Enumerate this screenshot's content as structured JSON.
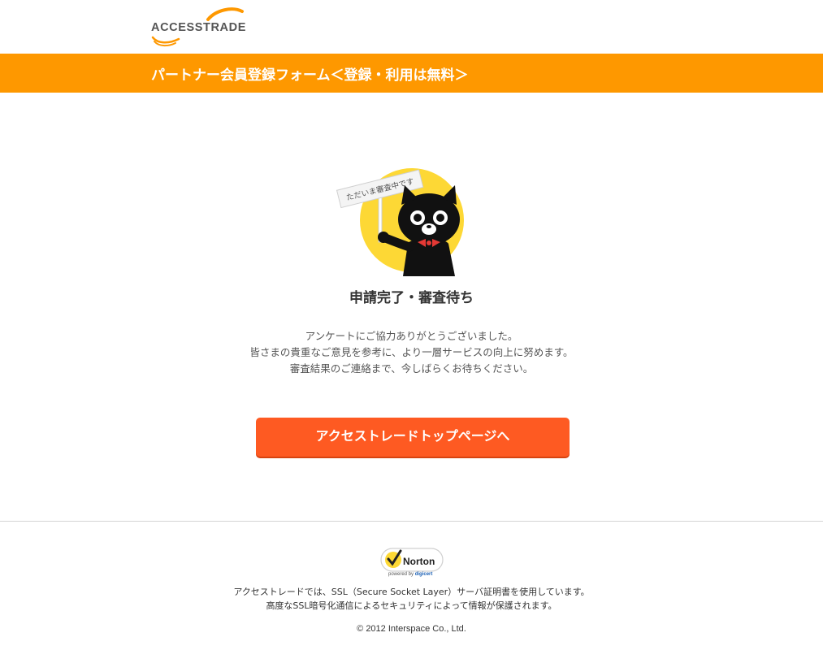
{
  "logo": {
    "text": "ACCESSTRADE"
  },
  "banner": {
    "title": "パートナー会員登録フォーム＜登録・利用は無料＞"
  },
  "mascot": {
    "sign_text": "ただいま審査中です"
  },
  "status": {
    "title": "申請完了・審査待ち"
  },
  "message": {
    "lines": [
      "アンケートにご協力ありがとうございました。",
      "皆さまの貴重なご意見を参考に、より一層サービスの向上に努めます。",
      "審査結果のご連絡まで、今しばらくお待ちください。"
    ]
  },
  "cta": {
    "label": "アクセストレードトップページへ"
  },
  "footer": {
    "norton": {
      "brand": "Norton",
      "powered_by": "powered by",
      "digicert": "digicert"
    },
    "ssl_lines": [
      "アクセストレードでは、SSL（Secure Socket Layer）サーバ証明書を使用しています。",
      "高度なSSL暗号化通信によるセキュリティによって情報が保護されます。"
    ],
    "copyright": "© 2012 Interspace Co., Ltd."
  },
  "colors": {
    "banner": "#fe9800",
    "cta": "#fe5a22",
    "mascot_circle": "#fdd835"
  }
}
